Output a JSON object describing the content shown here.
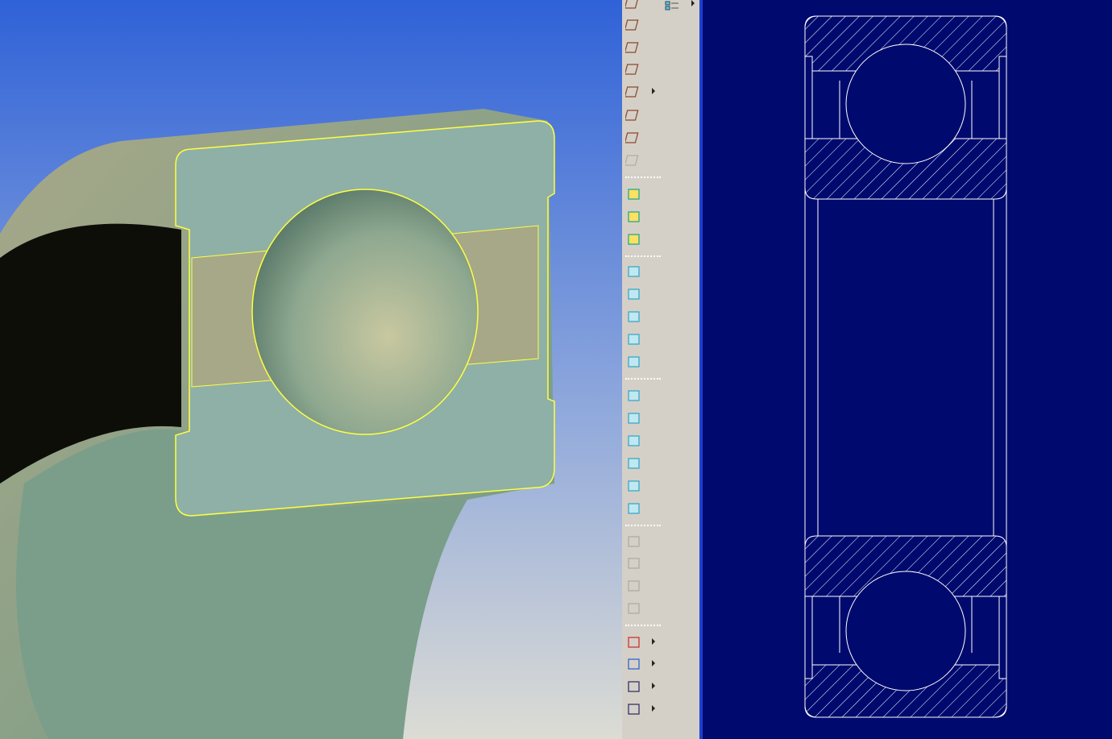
{
  "colors": {
    "viewport_top": "#2f62d8",
    "viewport_bottom": "#dcdcd4",
    "part_face": "#8fb0a6",
    "selection_edge": "#ffff40",
    "toolbar_bg": "#d4d0c8",
    "drawing_bg": "#000a6e",
    "drawing_lines": "#ffffff"
  },
  "toolbar": {
    "icons": [
      "curve-icon",
      "plane-icon",
      "line-icon",
      "spline-icon",
      "points-icon",
      "axis-system-icon",
      "point-on-surface-icon",
      "link-icon",
      "import-part-icon",
      "export-part-icon",
      "insert-part-icon",
      "extrude-icon",
      "symmetry-icon",
      "sweep-icon",
      "multi-section-icon",
      "fill-surface-icon",
      "pocket-icon",
      "shell-icon",
      "draft-icon",
      "chamfer-icon",
      "fillet-icon",
      "edge-fillet-icon",
      "mirror-icon",
      "transform-icon",
      "translate-icon",
      "pattern-icon",
      "measure-icon",
      "info-icon",
      "analysis-icon",
      "scale-save-icon"
    ],
    "list_icon": "tree-list-icon"
  }
}
